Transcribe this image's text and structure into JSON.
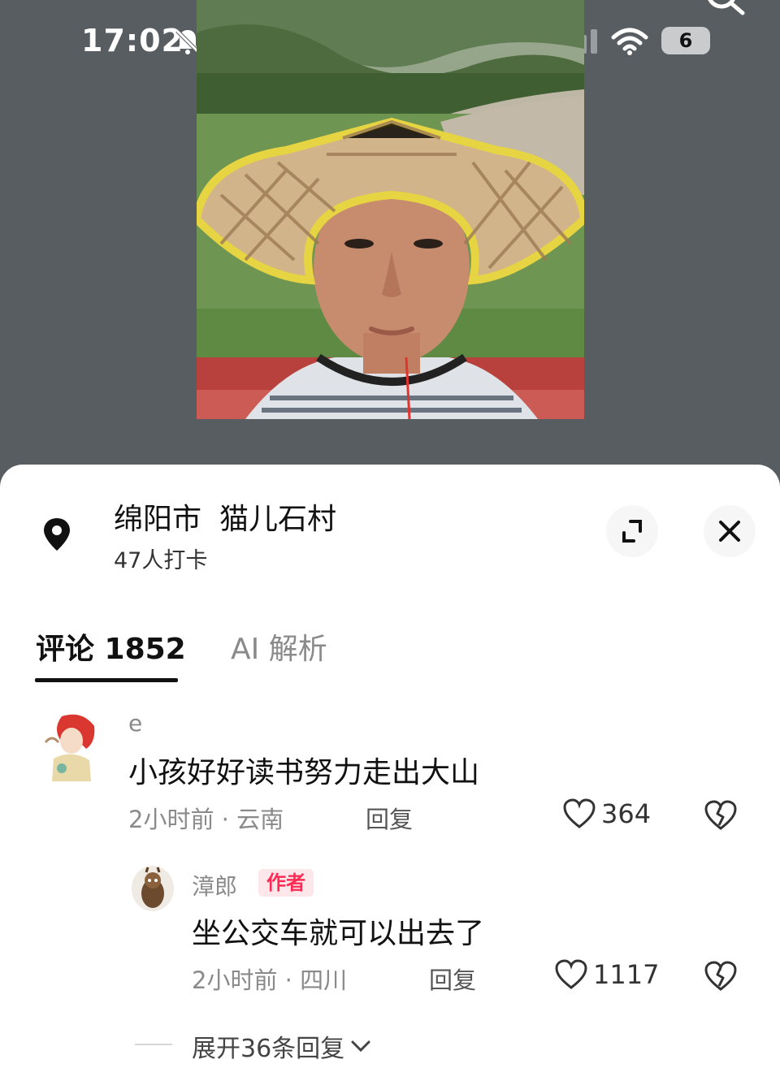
{
  "status_bar": {
    "time": "17:02",
    "battery_level": "6",
    "icons": [
      "bell-off-icon",
      "cellular-signal-icon",
      "wifi-icon",
      "battery-icon",
      "search-icon"
    ]
  },
  "location": {
    "city": "绵阳市",
    "village": "猫儿石村",
    "checkins": "47人打卡",
    "icon": "location-pin-icon"
  },
  "tabs": [
    {
      "label": "评论 1852",
      "active": true
    },
    {
      "label": "AI 解析",
      "active": false
    }
  ],
  "comments": [
    {
      "username": "e",
      "text": "小孩好好读书努力走出大山",
      "meta": "2小时前 · 云南",
      "reply_label": "回复",
      "likes": "364"
    },
    {
      "username": "漳郎",
      "badge": "作者",
      "text": "坐公交车就可以出去了",
      "meta": "2小时前 · 四川",
      "reply_label": "回复",
      "likes": "1117"
    }
  ],
  "expand_replies": "展开36条回复",
  "colors": {
    "background": "#585d62",
    "accent": "#fe2c55",
    "sheet": "#ffffff"
  }
}
